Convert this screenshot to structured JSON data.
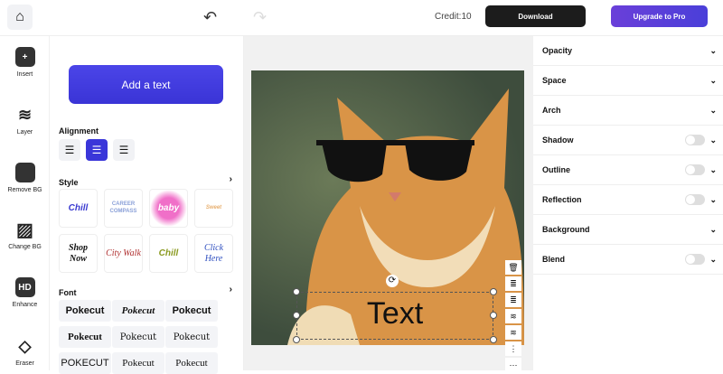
{
  "header": {
    "credit": "Credit:10",
    "download": "Download",
    "upgrade": "Upgrade to Pro"
  },
  "rail": [
    {
      "label": "Insert",
      "icon": "+"
    },
    {
      "label": "Layer",
      "icon": "≋"
    },
    {
      "label": "Remove BG",
      "icon": ""
    },
    {
      "label": "Change BG",
      "icon": "▨"
    },
    {
      "label": "Enhance",
      "icon": "HD"
    },
    {
      "label": "Eraser",
      "icon": "◇"
    }
  ],
  "panel": {
    "add_text": "Add a text",
    "alignment": "Alignment",
    "style": "Style",
    "font": "Font",
    "styles": [
      "Chill",
      "CAREER COMPASS",
      "baby",
      "Sweet",
      "Shop Now",
      "City Walk",
      "Chill",
      "Click Here"
    ],
    "fonts": [
      "Pokecut",
      "Pokecut",
      "Pokecut",
      "Pokecut",
      "Pokecut",
      "Pokecut",
      "POKECUT",
      "Pokecut",
      "Pokecut"
    ]
  },
  "canvas": {
    "text": "Text"
  },
  "properties": [
    {
      "label": "Opacity",
      "toggle": false
    },
    {
      "label": "Space",
      "toggle": false
    },
    {
      "label": "Arch",
      "toggle": false
    },
    {
      "label": "Shadow",
      "toggle": true
    },
    {
      "label": "Outline",
      "toggle": true
    },
    {
      "label": "Reflection",
      "toggle": true
    },
    {
      "label": "Background",
      "toggle": false
    },
    {
      "label": "Blend",
      "toggle": true
    }
  ]
}
